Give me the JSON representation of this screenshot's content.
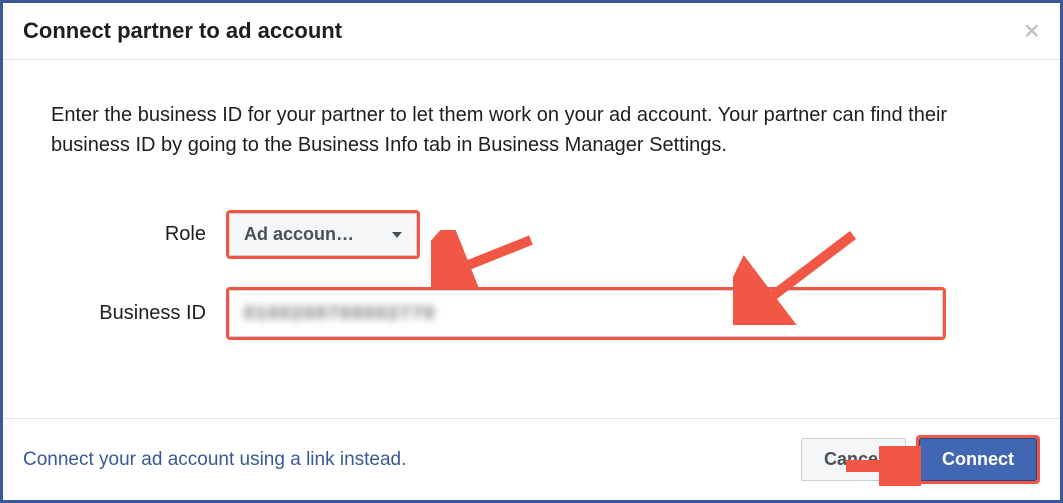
{
  "dialog": {
    "title": "Connect partner to ad account",
    "close_glyph": "×",
    "description": "Enter the business ID for your partner to let them work on your ad account. Your partner can find their business ID by going to the Business Info tab in Business Manager Settings.",
    "role_label": "Role",
    "role_value": "Ad accoun…",
    "business_id_label": "Business ID",
    "business_id_value": "0100200700002770",
    "link_text": "Connect your ad account using a link instead.",
    "cancel_label": "Cancel",
    "connect_label": "Connect"
  },
  "annotation_color": "#f15744"
}
